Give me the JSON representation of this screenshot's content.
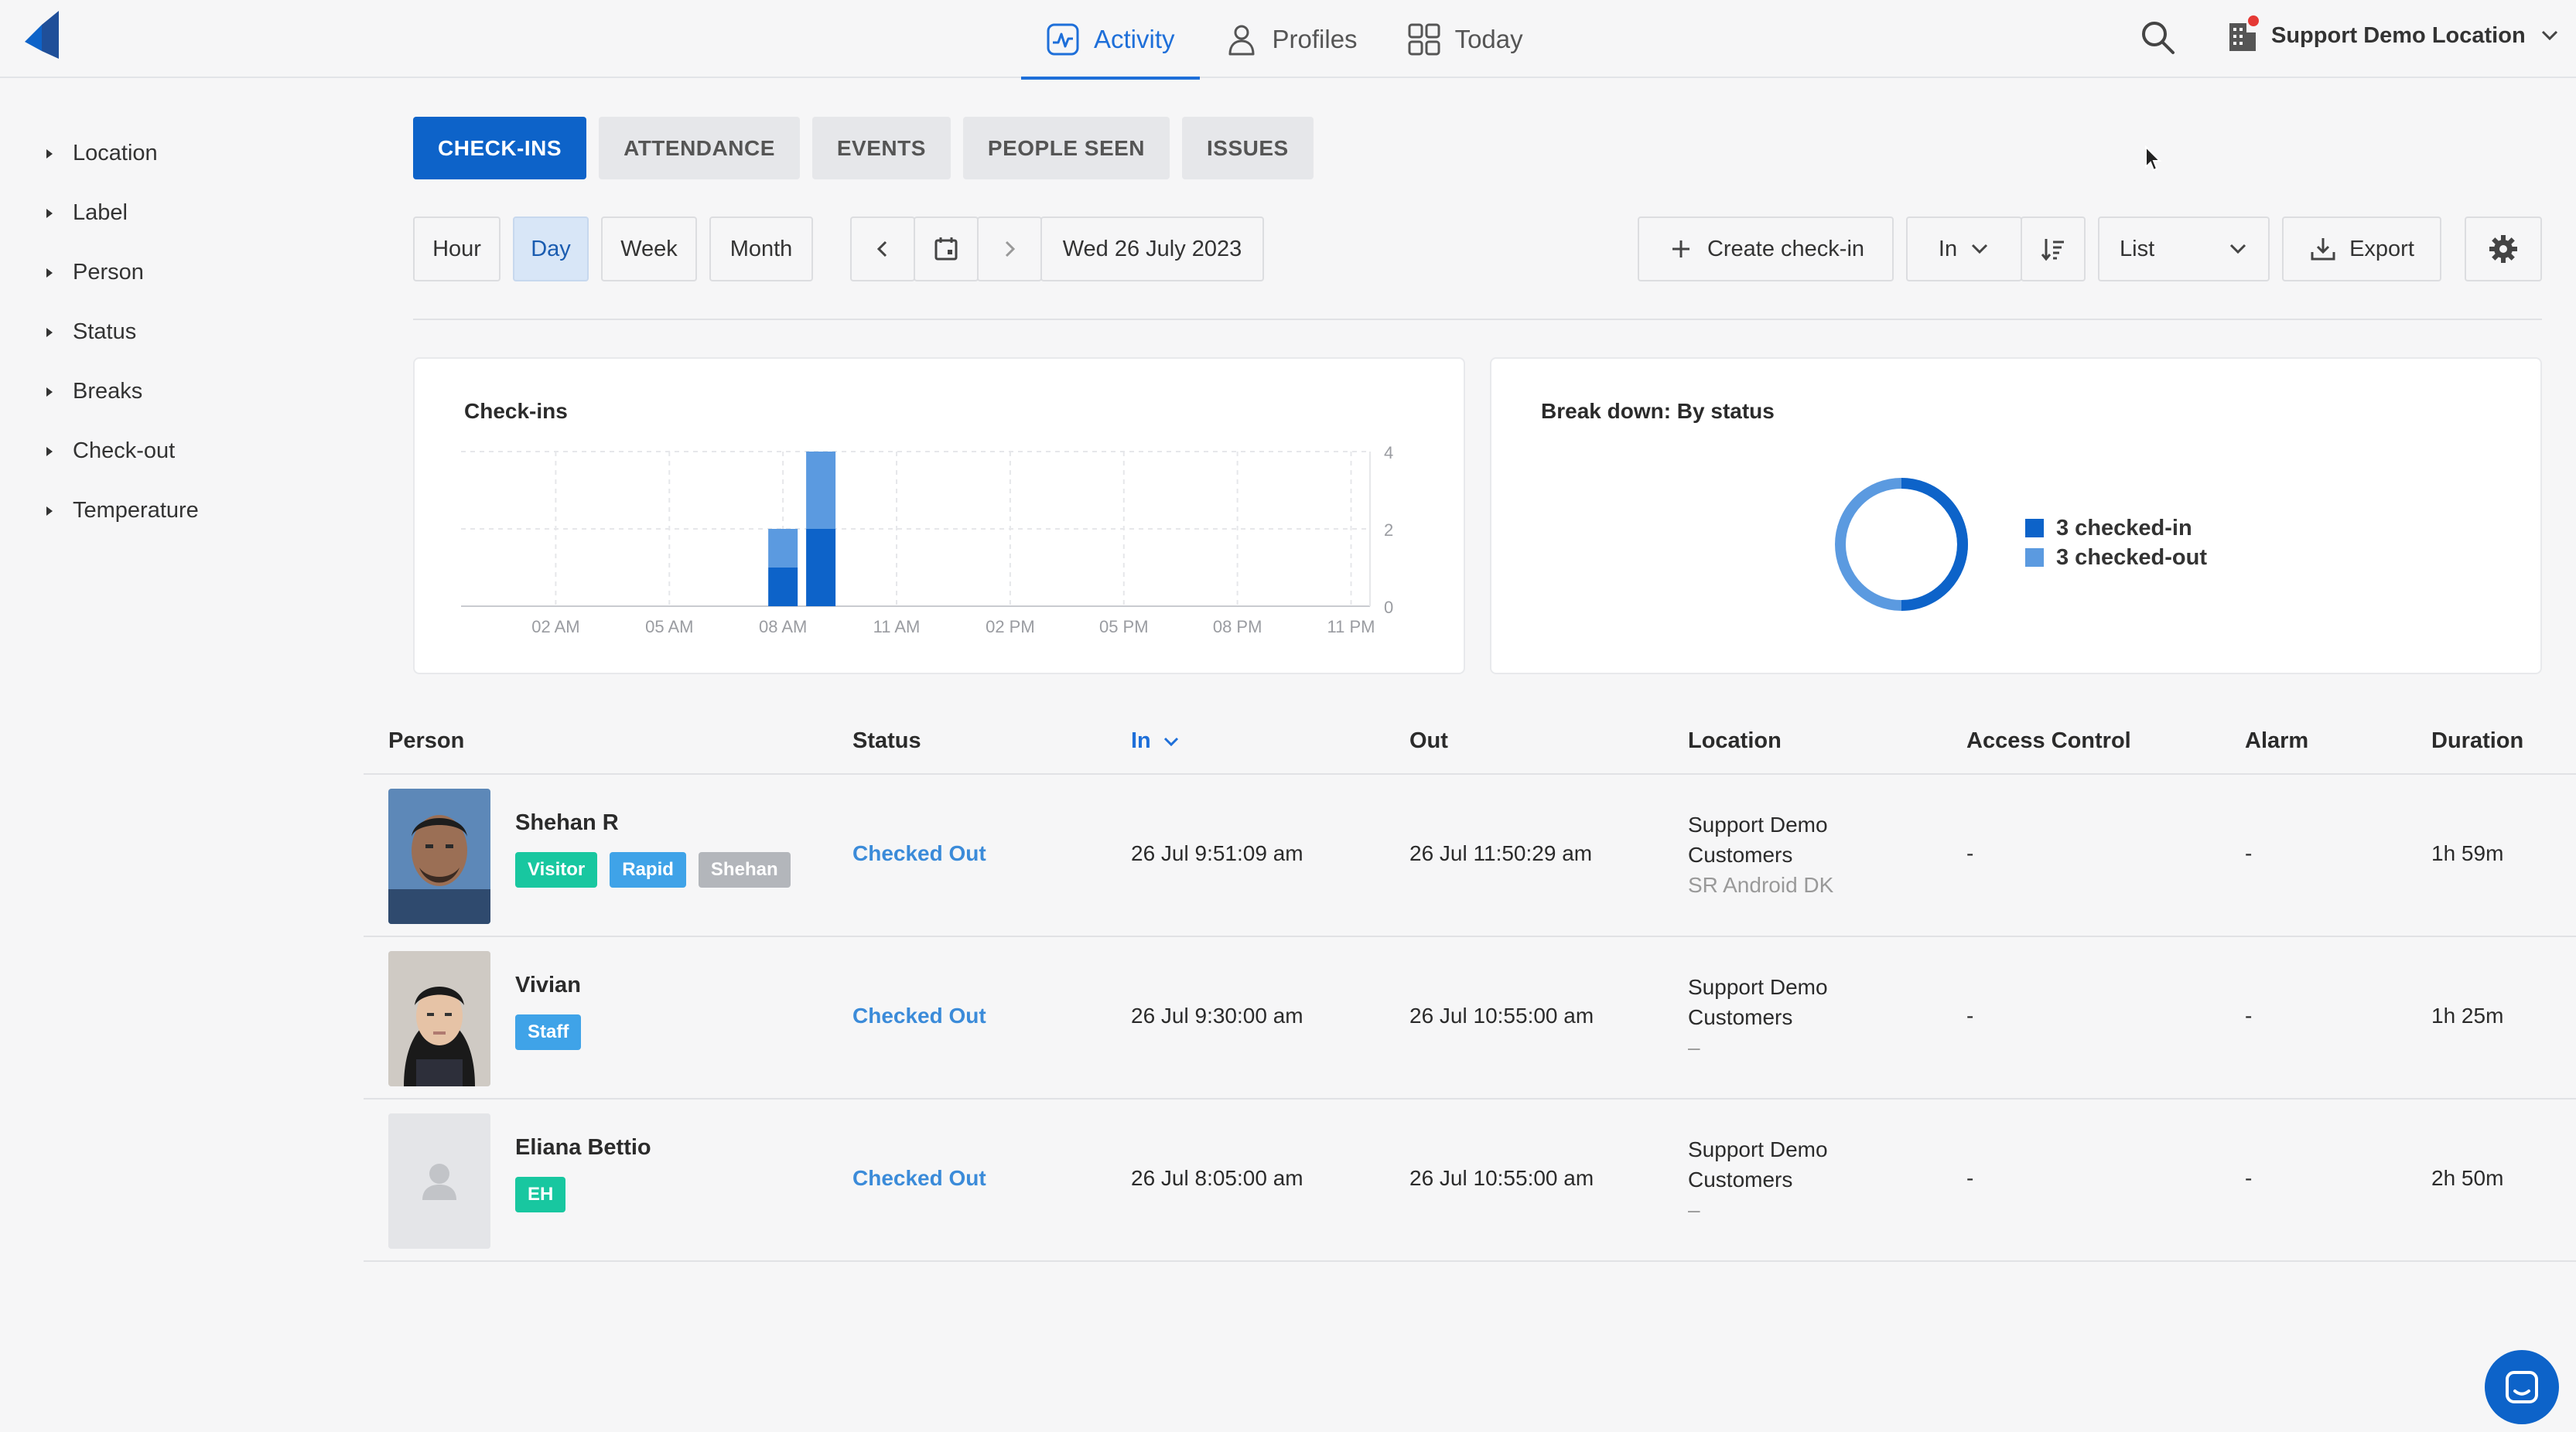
{
  "nav": {
    "items": [
      {
        "label": "Activity",
        "icon": "activity-icon",
        "active": true
      },
      {
        "label": "Profiles",
        "icon": "person-icon",
        "active": false
      },
      {
        "label": "Today",
        "icon": "grid-icon",
        "active": false
      }
    ],
    "location": "Support Demo Location"
  },
  "sidebar": {
    "filters": [
      "Location",
      "Label",
      "Person",
      "Status",
      "Breaks",
      "Check-out",
      "Temperature"
    ]
  },
  "tabs": [
    "CHECK-INS",
    "ATTENDANCE",
    "EVENTS",
    "PEOPLE SEEN",
    "ISSUES"
  ],
  "toolbar": {
    "periods": [
      "Hour",
      "Day",
      "Week",
      "Month"
    ],
    "selected_period": "Day",
    "date": "Wed 26 July 2023",
    "create": "Create check-in",
    "direction": "In",
    "view": "List",
    "export": "Export"
  },
  "checkins_card": {
    "title": "Check-ins"
  },
  "breakdown_card": {
    "title": "Break down: By status",
    "legend": [
      {
        "label": "3 checked-in",
        "color": "#0d63c9"
      },
      {
        "label": "3 checked-out",
        "color": "#5b9ae0"
      }
    ]
  },
  "chart_data": {
    "type": "bar",
    "stacked": true,
    "title": "Check-ins",
    "x_ticks": [
      "02 AM",
      "05 AM",
      "08 AM",
      "11 AM",
      "02 PM",
      "05 PM",
      "08 PM",
      "11 PM"
    ],
    "y_ticks": [
      0,
      2,
      4
    ],
    "ylim": [
      0,
      4
    ],
    "categories": [
      "08 AM",
      "09 AM"
    ],
    "series": [
      {
        "name": "checked-in",
        "color": "#0d63c9",
        "values": [
          1,
          2
        ]
      },
      {
        "name": "checked-out",
        "color": "#5b9ae0",
        "values": [
          1,
          2
        ]
      }
    ]
  },
  "donut": {
    "checked_in": 3,
    "checked_out": 3
  },
  "table": {
    "headers": {
      "person": "Person",
      "status": "Status",
      "in": "In",
      "out": "Out",
      "location": "Location",
      "access": "Access Control",
      "alarm": "Alarm",
      "duration": "Duration"
    },
    "rows": [
      {
        "name": "Shehan R",
        "badges": [
          {
            "label": "Visitor",
            "color": "#18c7a0"
          },
          {
            "label": "Rapid",
            "color": "#3fa3e8"
          },
          {
            "label": "Shehan",
            "color": "#b3b6bb"
          }
        ],
        "status": "Checked Out",
        "in": "26 Jul 9:51:09 am",
        "out": "26 Jul 11:50:29 am",
        "location1": "Support Demo",
        "location2": "Customers",
        "location3": "SR Android DK",
        "access": "-",
        "alarm": "-",
        "duration": "1h 59m"
      },
      {
        "name": "Vivian",
        "badges": [
          {
            "label": "Staff",
            "color": "#3fa3e8"
          }
        ],
        "status": "Checked Out",
        "in": "26 Jul 9:30:00 am",
        "out": "26 Jul 10:55:00 am",
        "location1": "Support Demo",
        "location2": "Customers",
        "location3": "–",
        "access": "-",
        "alarm": "-",
        "duration": "1h 25m"
      },
      {
        "name": "Eliana Bettio",
        "badges": [
          {
            "label": "EH",
            "color": "#18c7a0"
          }
        ],
        "status": "Checked Out",
        "in": "26 Jul 8:05:00 am",
        "out": "26 Jul 10:55:00 am",
        "location1": "Support Demo",
        "location2": "Customers",
        "location3": "–",
        "access": "-",
        "alarm": "-",
        "duration": "2h 50m"
      }
    ]
  }
}
